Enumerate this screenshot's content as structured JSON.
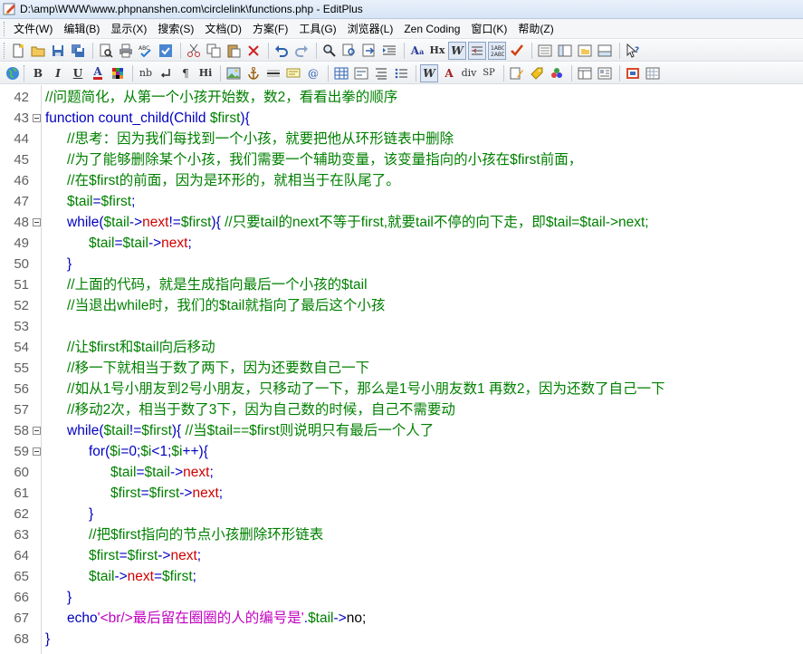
{
  "window": {
    "title": "D:\\amp\\WWW\\www.phpnanshen.com\\circlelink\\functions.php - EditPlus"
  },
  "menu": [
    "文件(W)",
    "编辑(B)",
    "显示(X)",
    "搜索(S)",
    "文档(D)",
    "方案(F)",
    "工具(G)",
    "浏览器(L)",
    "Zen Coding",
    "窗口(K)",
    "帮助(Z)"
  ],
  "toolbar2_text": {
    "bold": "B",
    "italic": "I",
    "underline": "U",
    "font_color": "A",
    "nb": "nb",
    "hi": "Hi",
    "ax": "A",
    "hx": "Hx",
    "div": "div",
    "sp": "SP"
  },
  "code_lines": [
    {
      "n": "42",
      "fold": false,
      "indent": 0,
      "tokens": [
        {
          "t": "c",
          "v": "//问题简化，从第一个小孩开始数，数2，看看出拳的顺序"
        }
      ]
    },
    {
      "n": "43",
      "fold": true,
      "indent": 0,
      "tokens": [
        {
          "t": "k",
          "v": "function count_child(Child "
        },
        {
          "t": "v",
          "v": "$first"
        },
        {
          "t": "k",
          "v": "){"
        }
      ]
    },
    {
      "n": "44",
      "fold": false,
      "indent": 1,
      "tokens": [
        {
          "t": "c",
          "v": "//思考：因为我们每找到一个小孩，就要把他从环形链表中删除"
        }
      ]
    },
    {
      "n": "45",
      "fold": false,
      "indent": 1,
      "tokens": [
        {
          "t": "c",
          "v": "//为了能够删除某个小孩，我们需要一个辅助变量，该变量指向的小孩在$first前面，"
        }
      ]
    },
    {
      "n": "46",
      "fold": false,
      "indent": 1,
      "tokens": [
        {
          "t": "c",
          "v": "//在$first的前面，因为是环形的，就相当于在队尾了。"
        }
      ]
    },
    {
      "n": "47",
      "fold": false,
      "indent": 1,
      "tokens": [
        {
          "t": "v",
          "v": "$tail"
        },
        {
          "t": "k",
          "v": "="
        },
        {
          "t": "v",
          "v": "$first"
        },
        {
          "t": "k",
          "v": ";"
        }
      ]
    },
    {
      "n": "48",
      "fold": true,
      "indent": 1,
      "tokens": [
        {
          "t": "k",
          "v": "while("
        },
        {
          "t": "v",
          "v": "$tail"
        },
        {
          "t": "k",
          "v": "->"
        },
        {
          "t": "p",
          "v": "next"
        },
        {
          "t": "k",
          "v": "!="
        },
        {
          "t": "v",
          "v": "$first"
        },
        {
          "t": "k",
          "v": "){ "
        },
        {
          "t": "c",
          "v": "//只要tail的next不等于first,就要tail不停的向下走，即$tail=$tail->next;"
        }
      ]
    },
    {
      "n": "49",
      "fold": false,
      "indent": 2,
      "tokens": [
        {
          "t": "v",
          "v": "$tail"
        },
        {
          "t": "k",
          "v": "="
        },
        {
          "t": "v",
          "v": "$tail"
        },
        {
          "t": "k",
          "v": "->"
        },
        {
          "t": "p",
          "v": "next"
        },
        {
          "t": "k",
          "v": ";"
        }
      ]
    },
    {
      "n": "50",
      "fold": false,
      "indent": 1,
      "tokens": [
        {
          "t": "k",
          "v": "}"
        }
      ]
    },
    {
      "n": "51",
      "fold": false,
      "indent": 1,
      "tokens": [
        {
          "t": "c",
          "v": "//上面的代码，就是生成指向最后一个小孩的$tail"
        }
      ]
    },
    {
      "n": "52",
      "fold": false,
      "indent": 1,
      "tokens": [
        {
          "t": "c",
          "v": "//当退出while时，我们的$tail就指向了最后这个小孩"
        }
      ]
    },
    {
      "n": "53",
      "fold": false,
      "indent": 0,
      "tokens": []
    },
    {
      "n": "54",
      "fold": false,
      "indent": 1,
      "tokens": [
        {
          "t": "c",
          "v": "//让$first和$tail向后移动"
        }
      ]
    },
    {
      "n": "55",
      "fold": false,
      "indent": 1,
      "tokens": [
        {
          "t": "c",
          "v": "//移一下就相当于数了两下，因为还要数自己一下"
        }
      ]
    },
    {
      "n": "56",
      "fold": false,
      "indent": 1,
      "tokens": [
        {
          "t": "c",
          "v": "//如从1号小朋友到2号小朋友，只移动了一下，那么是1号小朋友数1 再数2，因为还数了自己一下"
        }
      ]
    },
    {
      "n": "57",
      "fold": false,
      "indent": 1,
      "tokens": [
        {
          "t": "c",
          "v": "//移动2次，相当于数了3下，因为自己数的时候，自己不需要动"
        }
      ]
    },
    {
      "n": "58",
      "fold": true,
      "indent": 1,
      "tokens": [
        {
          "t": "k",
          "v": "while("
        },
        {
          "t": "v",
          "v": "$tail"
        },
        {
          "t": "k",
          "v": "!="
        },
        {
          "t": "v",
          "v": "$first"
        },
        {
          "t": "k",
          "v": "){ "
        },
        {
          "t": "c",
          "v": "//当$tail==$first则说明只有最后一个人了"
        }
      ]
    },
    {
      "n": "59",
      "fold": true,
      "indent": 2,
      "tokens": [
        {
          "t": "k",
          "v": "for("
        },
        {
          "t": "v",
          "v": "$i"
        },
        {
          "t": "k",
          "v": "=0;"
        },
        {
          "t": "v",
          "v": "$i"
        },
        {
          "t": "k",
          "v": "<1;"
        },
        {
          "t": "v",
          "v": "$i"
        },
        {
          "t": "k",
          "v": "++){"
        }
      ]
    },
    {
      "n": "60",
      "fold": false,
      "indent": 3,
      "tokens": [
        {
          "t": "v",
          "v": "$tail"
        },
        {
          "t": "k",
          "v": "="
        },
        {
          "t": "v",
          "v": "$tail"
        },
        {
          "t": "k",
          "v": "->"
        },
        {
          "t": "p",
          "v": "next"
        },
        {
          "t": "k",
          "v": ";"
        }
      ]
    },
    {
      "n": "61",
      "fold": false,
      "indent": 3,
      "tokens": [
        {
          "t": "v",
          "v": "$first"
        },
        {
          "t": "k",
          "v": "="
        },
        {
          "t": "v",
          "v": "$first"
        },
        {
          "t": "k",
          "v": "->"
        },
        {
          "t": "p",
          "v": "next"
        },
        {
          "t": "k",
          "v": ";"
        }
      ]
    },
    {
      "n": "62",
      "fold": false,
      "indent": 2,
      "tokens": [
        {
          "t": "k",
          "v": "}"
        }
      ]
    },
    {
      "n": "63",
      "fold": false,
      "indent": 2,
      "tokens": [
        {
          "t": "c",
          "v": "//把$first指向的节点小孩删除环形链表"
        }
      ]
    },
    {
      "n": "64",
      "fold": false,
      "indent": 2,
      "tokens": [
        {
          "t": "v",
          "v": "$first"
        },
        {
          "t": "k",
          "v": "="
        },
        {
          "t": "v",
          "v": "$first"
        },
        {
          "t": "k",
          "v": "->"
        },
        {
          "t": "p",
          "v": "next"
        },
        {
          "t": "k",
          "v": ";"
        }
      ]
    },
    {
      "n": "65",
      "fold": false,
      "indent": 2,
      "tokens": [
        {
          "t": "v",
          "v": "$tail"
        },
        {
          "t": "k",
          "v": "->"
        },
        {
          "t": "p",
          "v": "next"
        },
        {
          "t": "k",
          "v": "="
        },
        {
          "t": "v",
          "v": "$first"
        },
        {
          "t": "k",
          "v": ";"
        }
      ]
    },
    {
      "n": "66",
      "fold": false,
      "indent": 1,
      "tokens": [
        {
          "t": "k",
          "v": "}"
        }
      ]
    },
    {
      "n": "67",
      "fold": false,
      "indent": 1,
      "tokens": [
        {
          "t": "k",
          "v": "echo"
        },
        {
          "t": "s",
          "v": "'<br/>最后留在圈圈的人的编号是'"
        },
        {
          "t": "k",
          "v": "."
        },
        {
          "t": "v",
          "v": "$tail"
        },
        {
          "t": "k",
          "v": "->"
        },
        {
          "t": "x",
          "v": "no;"
        }
      ]
    },
    {
      "n": "68",
      "fold": false,
      "indent": 0,
      "tokens": [
        {
          "t": "k",
          "v": "}"
        }
      ]
    }
  ],
  "colors": {
    "comment": "#008000",
    "keyword": "#0000c0",
    "variable": "#008000",
    "property": "#d00000",
    "string": "#c000c0"
  },
  "icons": {
    "toolbar1": [
      "new-file-icon",
      "open-folder-icon",
      "save-icon",
      "save-all-icon",
      "print-preview-icon",
      "print-icon",
      "spellcheck-icon",
      "check-icon",
      "cut-icon",
      "copy-icon",
      "paste-icon",
      "delete-icon",
      "undo-icon",
      "redo-icon",
      "find-icon",
      "replace-icon",
      "goto-icon",
      "indent-icon",
      "font-size-icon",
      "hex-icon",
      "word-wrap-icon",
      "line-numbers-icon",
      "column-icon",
      "checkmark-icon",
      "window-list-icon",
      "cliptext-icon",
      "directory-icon",
      "output-icon",
      "help-icon"
    ],
    "toolbar2": [
      "browser-icon",
      "bold-icon",
      "italic-icon",
      "underline-icon",
      "font-color-icon",
      "color-grid-icon",
      "nbsp-icon",
      "br-icon",
      "paragraph-icon",
      "heading-icon",
      "image-icon",
      "anchor-icon",
      "hr-icon",
      "comment-icon",
      "table-icon",
      "form-icon",
      "list-icon",
      "ordered-list-icon",
      "html-icon",
      "div-icon",
      "span-icon",
      "edit-icon",
      "tag-icon",
      "css-icon",
      "frame-icon",
      "preview-icon"
    ]
  }
}
